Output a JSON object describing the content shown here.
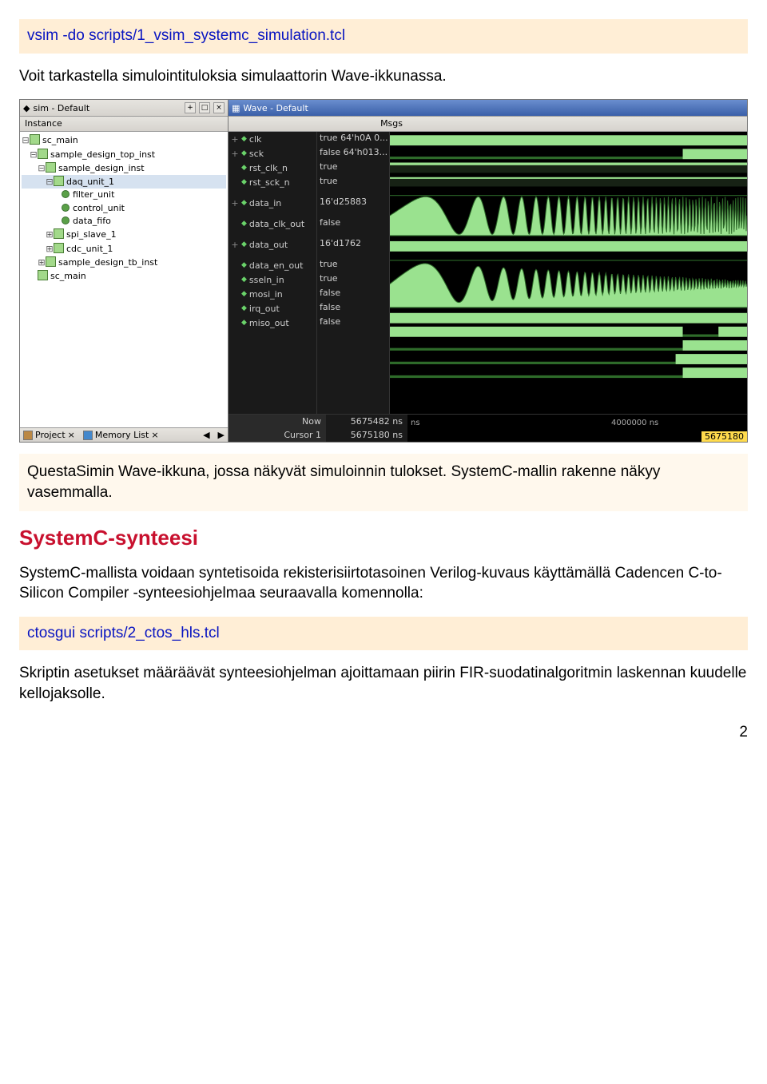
{
  "command1": "vsim -do scripts/1_vsim_systemc_simulation.tcl",
  "paragraph1": "Voit tarkastella simulointituloksia simulaattorin Wave-ikkunassa.",
  "screenshot": {
    "leftPanel": {
      "title": "sim - Default",
      "columnHeader": "Instance",
      "tree": [
        {
          "indent": 0,
          "expander": "-",
          "type": "mod",
          "label": "sc_main"
        },
        {
          "indent": 1,
          "expander": "-",
          "type": "mod",
          "label": "sample_design_top_inst"
        },
        {
          "indent": 2,
          "expander": "-",
          "type": "mod",
          "label": "sample_design_inst"
        },
        {
          "indent": 3,
          "expander": "-",
          "type": "mod",
          "label": "daq_unit_1",
          "selected": true
        },
        {
          "indent": 4,
          "expander": "",
          "type": "leaf",
          "label": "filter_unit"
        },
        {
          "indent": 4,
          "expander": "",
          "type": "leaf",
          "label": "control_unit"
        },
        {
          "indent": 4,
          "expander": "",
          "type": "leaf",
          "label": "data_fifo"
        },
        {
          "indent": 3,
          "expander": "+",
          "type": "mod",
          "label": "spi_slave_1"
        },
        {
          "indent": 3,
          "expander": "+",
          "type": "mod",
          "label": "cdc_unit_1"
        },
        {
          "indent": 2,
          "expander": "+",
          "type": "mod",
          "label": "sample_design_tb_inst"
        },
        {
          "indent": 1,
          "expander": "",
          "type": "mod",
          "label": "sc_main"
        }
      ],
      "bottomTabs": {
        "tab1": "Project",
        "tab2": "Memory List"
      }
    },
    "wavePanel": {
      "title": "Wave - Default",
      "msgsHeader": "Msgs",
      "signals": [
        {
          "name": "clk",
          "value": "true 64'h0A 0...",
          "exp": "+"
        },
        {
          "name": "sck",
          "value": "false 64'h013...",
          "exp": "+"
        },
        {
          "name": "rst_clk_n",
          "value": "true",
          "exp": ""
        },
        {
          "name": "rst_sck_n",
          "value": "true",
          "exp": ""
        },
        {
          "name": "",
          "value": "",
          "gap": true
        },
        {
          "name": "data_in",
          "value": "16'd25883",
          "exp": "+"
        },
        {
          "name": "",
          "value": "",
          "gap": true
        },
        {
          "name": "data_clk_out",
          "value": "false",
          "exp": ""
        },
        {
          "name": "",
          "value": "",
          "gap": true
        },
        {
          "name": "data_out",
          "value": "16'd1762",
          "exp": "+"
        },
        {
          "name": "",
          "value": "",
          "gap": true
        },
        {
          "name": "data_en_out",
          "value": "true",
          "exp": ""
        },
        {
          "name": "sseln_in",
          "value": "true",
          "exp": ""
        },
        {
          "name": "mosi_in",
          "value": "false",
          "exp": ""
        },
        {
          "name": "irq_out",
          "value": "false",
          "exp": ""
        },
        {
          "name": "miso_out",
          "value": "false",
          "exp": ""
        }
      ],
      "statusRows": {
        "now": {
          "label": "Now",
          "value": "5675482 ns",
          "tickLabel": "ns",
          "tickMid": "4000000 ns"
        },
        "cursor": {
          "label": "Cursor 1",
          "value": "5675180 ns",
          "endLabel": "5675180"
        }
      }
    }
  },
  "caption": "QuestaSimin Wave-ikkuna, jossa näkyvät simuloinnin tulokset. SystemC-mallin rakenne näkyy vasemmalla.",
  "sectionHead": "SystemC-synteesi",
  "paragraph2": "SystemC-mallista voidaan syntetisoida rekisterisiirtotasoinen Verilog-kuvaus käyttämällä Cadencen C-to-Silicon Compiler -synteesiohjelmaa seuraavalla komennolla:",
  "command2": "ctosgui scripts/2_ctos_hls.tcl",
  "paragraph3": "Skriptin asetukset määräävät synteesiohjelman ajoittamaan piirin FIR-suodatinalgoritmin laskennan kuudelle kellojaksolle.",
  "pageNumber": "2"
}
